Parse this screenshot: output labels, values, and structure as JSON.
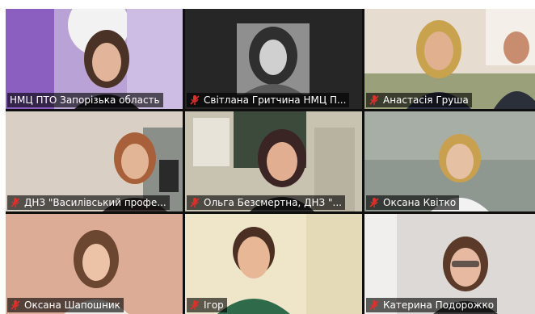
{
  "participants": [
    {
      "name": "НМЦ ПТО Запорізька область",
      "muted": false,
      "active": true
    },
    {
      "name": "Світлана Гритчина НМЦ П...",
      "muted": true,
      "active": false
    },
    {
      "name": "Анастасія Груша",
      "muted": true,
      "active": false
    },
    {
      "name": "ДНЗ \"Василівський профе...",
      "muted": true,
      "active": false
    },
    {
      "name": "Ольга Безсмертна, ДНЗ \"...",
      "muted": true,
      "active": false
    },
    {
      "name": "Оксана Квітко",
      "muted": true,
      "active": false
    },
    {
      "name": "Оксана Шапошник",
      "muted": true,
      "active": false
    },
    {
      "name": "Ігор",
      "muted": true,
      "active": false
    },
    {
      "name": "Катерина Подорожко",
      "muted": true,
      "active": false
    }
  ],
  "colors": {
    "active_speaker_border": "#e6e93a",
    "mute_icon": "#e0302a",
    "name_bar_text": "#ffffff"
  },
  "icons": {
    "mute": "microphone-muted-icon"
  }
}
